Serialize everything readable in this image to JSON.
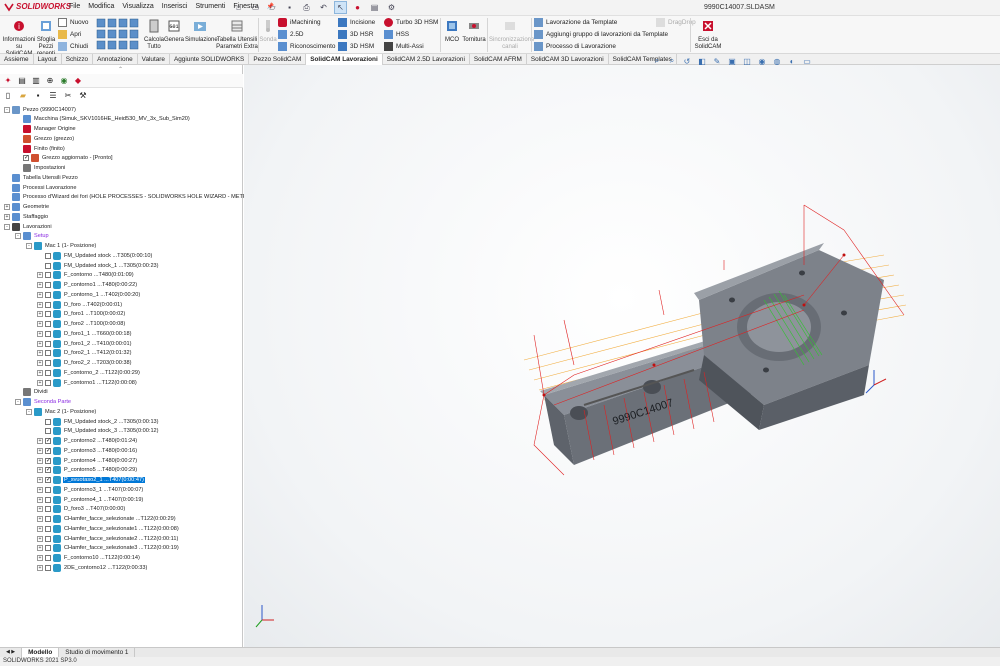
{
  "app": {
    "logo_text": "SOLIDWORKS",
    "document_title": "9990C14007.SLDASM"
  },
  "menu": [
    "File",
    "Modifica",
    "Visualizza",
    "Inserisci",
    "Strumenti",
    "Finestra"
  ],
  "ribbon": {
    "info_label_1": "Informazioni",
    "info_label_2": "su SolidCAM",
    "browse_label_1": "Sfoglia",
    "browse_label_2": "Pezzi",
    "browse_label_3": "recenti",
    "nuovo": "Nuovo",
    "apri": "Apri",
    "chiudi": "Chiudi",
    "calcola_1": "Calcola",
    "calcola_2": "Tutto",
    "genera": "Genera",
    "simulazione": "Simulazione",
    "tabella_1": "Tabella Utensili",
    "tabella_2": "Parametri Extra",
    "sonda": "Sonda",
    "imachining": "iMachining",
    "op_25d": "2.5D",
    "riconoscimento": "Riconoscimento",
    "incisione": "Incisione",
    "hsr_3d": "3D HSR",
    "hsm_3d": "3D HSM",
    "turbo": "Turbo 3D HSM",
    "hss": "HSS",
    "multiassi": "Multi-Assi",
    "mco": "MCO",
    "tornitura": "Tornitura",
    "sincro_1": "Sincronizzazione",
    "sincro_2": "canali",
    "lav_template": "Lavorazione da Template",
    "gruppo_template": "Aggiungi gruppo di lavorazioni da Template",
    "processo": "Processo di Lavorazione",
    "dragdrop": "DragDrop",
    "esci_1": "Esci da",
    "esci_2": "SolidCAM"
  },
  "tabs": [
    "Assieme",
    "Layout",
    "Schizzo",
    "Annotazione",
    "Valutare",
    "Aggiunte SOLIDWORKS",
    "Pezzo SolidCAM",
    "SolidCAM Lavorazioni",
    "SolidCAM 2.5D Lavorazioni",
    "SolidCAM AFRM",
    "SolidCAM 3D Lavorazioni",
    "SolidCAM Templates"
  ],
  "active_tab": "SolidCAM Lavorazioni",
  "tree": [
    {
      "label": "Pezzo (9990C14007)",
      "level": 0,
      "exp": "-",
      "chk": false,
      "icon": "part-icon"
    },
    {
      "label": "Macchina (Simuk_SKV1016HE_Heid530_MV_3x_Sub_Sim20)",
      "level": 1,
      "exp": "",
      "chk": false,
      "icon": "machine-icon"
    },
    {
      "label": "Manager Origine",
      "level": 1,
      "exp": "",
      "chk": false,
      "icon": "origin-icon"
    },
    {
      "label": "Grezzo (grezzo)",
      "level": 1,
      "exp": "",
      "chk": false,
      "icon": "stock-icon"
    },
    {
      "label": "Finito (finito)",
      "level": 1,
      "exp": "",
      "chk": false,
      "icon": "target-icon"
    },
    {
      "label": "Grezzo aggiornato - [Pronto]",
      "level": 1,
      "exp": "",
      "chk": true,
      "icon": "stock-icon"
    },
    {
      "label": "Impostazioni",
      "level": 1,
      "exp": "",
      "chk": false,
      "icon": "settings-icon"
    },
    {
      "label": "Tabella Utensili Pezzo",
      "level": 0,
      "exp": "",
      "chk": false,
      "icon": "tool-table-icon"
    },
    {
      "label": "Processi Lavorazione",
      "level": 0,
      "exp": "",
      "chk": false,
      "icon": "process-icon"
    },
    {
      "label": "Processo d'Wizard dei fori (HOLE PROCESSES - SOLIDWORKS HOLE WIZARD - METRIC)",
      "level": 0,
      "exp": "",
      "chk": false,
      "icon": "process-icon"
    },
    {
      "label": "Geometrie",
      "level": 0,
      "exp": "+",
      "chk": false,
      "icon": "geometry-icon"
    },
    {
      "label": "Staffaggio",
      "level": 0,
      "exp": "+",
      "chk": false,
      "icon": "fixture-icon"
    },
    {
      "label": "Lavorazioni",
      "level": 0,
      "exp": "-",
      "chk": false,
      "icon": "operations-icon"
    },
    {
      "label": "Setup",
      "level": 1,
      "exp": "-",
      "chk": false,
      "icon": "setup-icon",
      "purple": true
    },
    {
      "label": "Mac 1 (1- Posizione)",
      "level": 2,
      "exp": "-",
      "chk": false,
      "icon": "position-icon"
    },
    {
      "label": "FM_Updated stock ...T305(0:00:10)",
      "level": 3,
      "exp": "",
      "chk": false,
      "icon": "op-icon"
    },
    {
      "label": "FM_Updated stock_1 ...T305(0:00:23)",
      "level": 3,
      "exp": "",
      "chk": false,
      "icon": "op-icon"
    },
    {
      "label": "F_contorno ...T480(0:01:09)",
      "level": 3,
      "exp": "+",
      "chk": false,
      "icon": "op-icon"
    },
    {
      "label": "P_contorno1 ...T480(0:00:22)",
      "level": 3,
      "exp": "+",
      "chk": false,
      "icon": "op-icon"
    },
    {
      "label": "P_contorno_1 ...T402(0:00:20)",
      "level": 3,
      "exp": "+",
      "chk": false,
      "icon": "op-icon"
    },
    {
      "label": "D_foro ...T402(0:00:01)",
      "level": 3,
      "exp": "+",
      "chk": false,
      "icon": "op-icon"
    },
    {
      "label": "D_foro1 ...T100(0:00:02)",
      "level": 3,
      "exp": "+",
      "chk": false,
      "icon": "op-icon"
    },
    {
      "label": "D_foro2 ...T100(0:00:08)",
      "level": 3,
      "exp": "+",
      "chk": false,
      "icon": "op-icon"
    },
    {
      "label": "D_foro1_1 ...T660(0:00:18)",
      "level": 3,
      "exp": "+",
      "chk": false,
      "icon": "op-icon"
    },
    {
      "label": "D_foro1_2 ...T410(0:00:01)",
      "level": 3,
      "exp": "+",
      "chk": false,
      "icon": "op-icon"
    },
    {
      "label": "D_foro2_1 ...T412(0:01:32)",
      "level": 3,
      "exp": "+",
      "chk": false,
      "icon": "op-icon"
    },
    {
      "label": "D_foro2_2 ...T203(0:00:38)",
      "level": 3,
      "exp": "+",
      "chk": false,
      "icon": "op-icon"
    },
    {
      "label": "F_contorno_2 ...T122(0:00:29)",
      "level": 3,
      "exp": "+",
      "chk": false,
      "icon": "op-icon"
    },
    {
      "label": "F_contorno1 ...T122(0:00:08)",
      "level": 3,
      "exp": "+",
      "chk": false,
      "icon": "op-icon"
    },
    {
      "label": "Dividi",
      "level": 1,
      "exp": "",
      "chk": false,
      "icon": "split-icon"
    },
    {
      "label": "Seconda Parte",
      "level": 1,
      "exp": "-",
      "chk": false,
      "icon": "setup-icon",
      "purple": true
    },
    {
      "label": "Mac 2 (1- Posizione)",
      "level": 2,
      "exp": "-",
      "chk": false,
      "icon": "position-icon"
    },
    {
      "label": "FM_Updated stock_2 ...T305(0:00:13)",
      "level": 3,
      "exp": "",
      "chk": false,
      "icon": "op-icon"
    },
    {
      "label": "FM_Updated stock_3 ...T305(0:00:12)",
      "level": 3,
      "exp": "",
      "chk": false,
      "icon": "op-icon"
    },
    {
      "label": "P_contorno2 ...T480(0:01:24)",
      "level": 3,
      "exp": "+",
      "chk": true,
      "icon": "op-icon"
    },
    {
      "label": "P_contorno3 ...T480(0:00:16)",
      "level": 3,
      "exp": "+",
      "chk": true,
      "icon": "op-icon"
    },
    {
      "label": "P_contorno4 ...T480(0:00:27)",
      "level": 3,
      "exp": "+",
      "chk": true,
      "icon": "op-icon"
    },
    {
      "label": "P_contorno5 ...T480(0:00:29)",
      "level": 3,
      "exp": "+",
      "chk": true,
      "icon": "op-icon"
    },
    {
      "label": "P_svuotaso2_1 ...T407(0:00:47)",
      "level": 3,
      "exp": "+",
      "chk": true,
      "icon": "op-icon",
      "selected": true
    },
    {
      "label": "P_contorno3_1 ...T407(0:00:07)",
      "level": 3,
      "exp": "+",
      "chk": false,
      "icon": "op-icon"
    },
    {
      "label": "P_contorno4_1 ...T407(0:00:19)",
      "level": 3,
      "exp": "+",
      "chk": false,
      "icon": "op-icon"
    },
    {
      "label": "D_foro3 ...T407(0:00:00)",
      "level": 3,
      "exp": "+",
      "chk": false,
      "icon": "op-icon"
    },
    {
      "label": "CHamfer_facce_selezionate ...T122(0:00:29)",
      "level": 3,
      "exp": "+",
      "chk": false,
      "icon": "op-icon"
    },
    {
      "label": "CHamfer_facce_selezionate1 ...T122(0:00:08)",
      "level": 3,
      "exp": "+",
      "chk": false,
      "icon": "op-icon"
    },
    {
      "label": "CHamfer_facce_selezionate2 ...T122(0:00:11)",
      "level": 3,
      "exp": "+",
      "chk": false,
      "icon": "op-icon"
    },
    {
      "label": "CHamfer_facce_selezionate3 ...T122(0:00:19)",
      "level": 3,
      "exp": "+",
      "chk": false,
      "icon": "op-icon"
    },
    {
      "label": "F_contorno10 ...T122(0:00:14)",
      "level": 3,
      "exp": "+",
      "chk": false,
      "icon": "op-icon"
    },
    {
      "label": "2DE_contorno12 ...T122(0:00:33)",
      "level": 3,
      "exp": "+",
      "chk": false,
      "icon": "op-icon"
    }
  ],
  "viewport": {
    "engraving": "9990C14007"
  },
  "bottom_tabs": [
    "Modello",
    "Studio di movimento 1"
  ],
  "status": "SOLIDWORKS 2021 SP3.0",
  "colors": {
    "accent": "#0078d7",
    "toolpath_red": "#e02020",
    "toolpath_orange": "#f0a020",
    "part": "#6b7280",
    "purple": "#8a2be2"
  }
}
